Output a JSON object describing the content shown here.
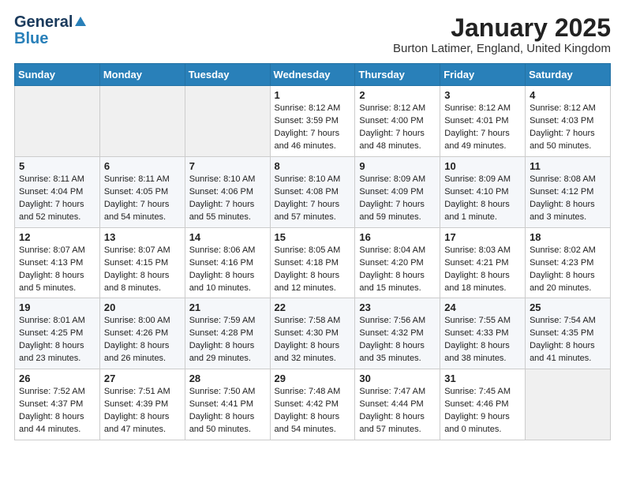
{
  "logo": {
    "general": "General",
    "blue": "Blue"
  },
  "header": {
    "title": "January 2025",
    "subtitle": "Burton Latimer, England, United Kingdom"
  },
  "weekdays": [
    "Sunday",
    "Monday",
    "Tuesday",
    "Wednesday",
    "Thursday",
    "Friday",
    "Saturday"
  ],
  "weeks": [
    [
      {
        "day": "",
        "info": ""
      },
      {
        "day": "",
        "info": ""
      },
      {
        "day": "",
        "info": ""
      },
      {
        "day": "1",
        "info": "Sunrise: 8:12 AM\nSunset: 3:59 PM\nDaylight: 7 hours and 46 minutes."
      },
      {
        "day": "2",
        "info": "Sunrise: 8:12 AM\nSunset: 4:00 PM\nDaylight: 7 hours and 48 minutes."
      },
      {
        "day": "3",
        "info": "Sunrise: 8:12 AM\nSunset: 4:01 PM\nDaylight: 7 hours and 49 minutes."
      },
      {
        "day": "4",
        "info": "Sunrise: 8:12 AM\nSunset: 4:03 PM\nDaylight: 7 hours and 50 minutes."
      }
    ],
    [
      {
        "day": "5",
        "info": "Sunrise: 8:11 AM\nSunset: 4:04 PM\nDaylight: 7 hours and 52 minutes."
      },
      {
        "day": "6",
        "info": "Sunrise: 8:11 AM\nSunset: 4:05 PM\nDaylight: 7 hours and 54 minutes."
      },
      {
        "day": "7",
        "info": "Sunrise: 8:10 AM\nSunset: 4:06 PM\nDaylight: 7 hours and 55 minutes."
      },
      {
        "day": "8",
        "info": "Sunrise: 8:10 AM\nSunset: 4:08 PM\nDaylight: 7 hours and 57 minutes."
      },
      {
        "day": "9",
        "info": "Sunrise: 8:09 AM\nSunset: 4:09 PM\nDaylight: 7 hours and 59 minutes."
      },
      {
        "day": "10",
        "info": "Sunrise: 8:09 AM\nSunset: 4:10 PM\nDaylight: 8 hours and 1 minute."
      },
      {
        "day": "11",
        "info": "Sunrise: 8:08 AM\nSunset: 4:12 PM\nDaylight: 8 hours and 3 minutes."
      }
    ],
    [
      {
        "day": "12",
        "info": "Sunrise: 8:07 AM\nSunset: 4:13 PM\nDaylight: 8 hours and 5 minutes."
      },
      {
        "day": "13",
        "info": "Sunrise: 8:07 AM\nSunset: 4:15 PM\nDaylight: 8 hours and 8 minutes."
      },
      {
        "day": "14",
        "info": "Sunrise: 8:06 AM\nSunset: 4:16 PM\nDaylight: 8 hours and 10 minutes."
      },
      {
        "day": "15",
        "info": "Sunrise: 8:05 AM\nSunset: 4:18 PM\nDaylight: 8 hours and 12 minutes."
      },
      {
        "day": "16",
        "info": "Sunrise: 8:04 AM\nSunset: 4:20 PM\nDaylight: 8 hours and 15 minutes."
      },
      {
        "day": "17",
        "info": "Sunrise: 8:03 AM\nSunset: 4:21 PM\nDaylight: 8 hours and 18 minutes."
      },
      {
        "day": "18",
        "info": "Sunrise: 8:02 AM\nSunset: 4:23 PM\nDaylight: 8 hours and 20 minutes."
      }
    ],
    [
      {
        "day": "19",
        "info": "Sunrise: 8:01 AM\nSunset: 4:25 PM\nDaylight: 8 hours and 23 minutes."
      },
      {
        "day": "20",
        "info": "Sunrise: 8:00 AM\nSunset: 4:26 PM\nDaylight: 8 hours and 26 minutes."
      },
      {
        "day": "21",
        "info": "Sunrise: 7:59 AM\nSunset: 4:28 PM\nDaylight: 8 hours and 29 minutes."
      },
      {
        "day": "22",
        "info": "Sunrise: 7:58 AM\nSunset: 4:30 PM\nDaylight: 8 hours and 32 minutes."
      },
      {
        "day": "23",
        "info": "Sunrise: 7:56 AM\nSunset: 4:32 PM\nDaylight: 8 hours and 35 minutes."
      },
      {
        "day": "24",
        "info": "Sunrise: 7:55 AM\nSunset: 4:33 PM\nDaylight: 8 hours and 38 minutes."
      },
      {
        "day": "25",
        "info": "Sunrise: 7:54 AM\nSunset: 4:35 PM\nDaylight: 8 hours and 41 minutes."
      }
    ],
    [
      {
        "day": "26",
        "info": "Sunrise: 7:52 AM\nSunset: 4:37 PM\nDaylight: 8 hours and 44 minutes."
      },
      {
        "day": "27",
        "info": "Sunrise: 7:51 AM\nSunset: 4:39 PM\nDaylight: 8 hours and 47 minutes."
      },
      {
        "day": "28",
        "info": "Sunrise: 7:50 AM\nSunset: 4:41 PM\nDaylight: 8 hours and 50 minutes."
      },
      {
        "day": "29",
        "info": "Sunrise: 7:48 AM\nSunset: 4:42 PM\nDaylight: 8 hours and 54 minutes."
      },
      {
        "day": "30",
        "info": "Sunrise: 7:47 AM\nSunset: 4:44 PM\nDaylight: 8 hours and 57 minutes."
      },
      {
        "day": "31",
        "info": "Sunrise: 7:45 AM\nSunset: 4:46 PM\nDaylight: 9 hours and 0 minutes."
      },
      {
        "day": "",
        "info": ""
      }
    ]
  ]
}
